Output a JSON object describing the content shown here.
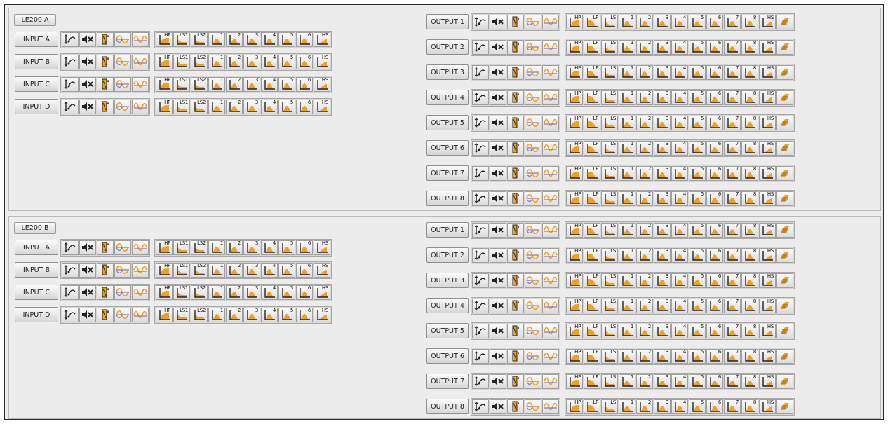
{
  "panels": [
    {
      "title": "LE200 A",
      "inputs": [
        "INPUT A",
        "INPUT B",
        "INPUT C",
        "INPUT D"
      ],
      "outputs": [
        "OUTPUT 1",
        "OUTPUT 2",
        "OUTPUT 3",
        "OUTPUT 4",
        "OUTPUT 5",
        "OUTPUT 6",
        "OUTPUT 7",
        "OUTPUT 8"
      ]
    },
    {
      "title": "LE200 B",
      "inputs": [
        "INPUT A",
        "INPUT B",
        "INPUT C",
        "INPUT D"
      ],
      "outputs": [
        "OUTPUT 1",
        "OUTPUT 2",
        "OUTPUT 3",
        "OUTPUT 4",
        "OUTPUT 5",
        "OUTPUT 6",
        "OUTPUT 7",
        "OUTPUT 8"
      ]
    }
  ],
  "input_buttons": [
    {
      "type": "routing"
    },
    {
      "type": "mute"
    },
    {
      "type": "gain"
    },
    {
      "type": "phase"
    },
    {
      "type": "delay"
    },
    {
      "type": "hp",
      "label": "HP"
    },
    {
      "type": "ls",
      "label": "LS1"
    },
    {
      "type": "ls",
      "label": "LS2"
    },
    {
      "type": "peq",
      "label": "1"
    },
    {
      "type": "peq",
      "label": "2"
    },
    {
      "type": "peq",
      "label": "3"
    },
    {
      "type": "peq",
      "label": "4"
    },
    {
      "type": "peq",
      "label": "5"
    },
    {
      "type": "peq",
      "label": "6"
    },
    {
      "type": "hs",
      "label": "HS"
    }
  ],
  "output_buttons": [
    {
      "type": "routing"
    },
    {
      "type": "mute"
    },
    {
      "type": "gain"
    },
    {
      "type": "phase"
    },
    {
      "type": "delay"
    },
    {
      "type": "hp",
      "label": "HP"
    },
    {
      "type": "lp",
      "label": "LP"
    },
    {
      "type": "ls",
      "label": "LS"
    },
    {
      "type": "peq",
      "label": "1"
    },
    {
      "type": "peq",
      "label": "2"
    },
    {
      "type": "peq",
      "label": "3"
    },
    {
      "type": "peq",
      "label": "4"
    },
    {
      "type": "peq",
      "label": "5"
    },
    {
      "type": "peq",
      "label": "6"
    },
    {
      "type": "peq",
      "label": "7"
    },
    {
      "type": "peq",
      "label": "8"
    },
    {
      "type": "hs",
      "label": "HS"
    },
    {
      "type": "limiter"
    }
  ],
  "colors": {
    "accent": "#f0a020",
    "panel_bg": "#ececec",
    "border": "#2a2a2a"
  }
}
